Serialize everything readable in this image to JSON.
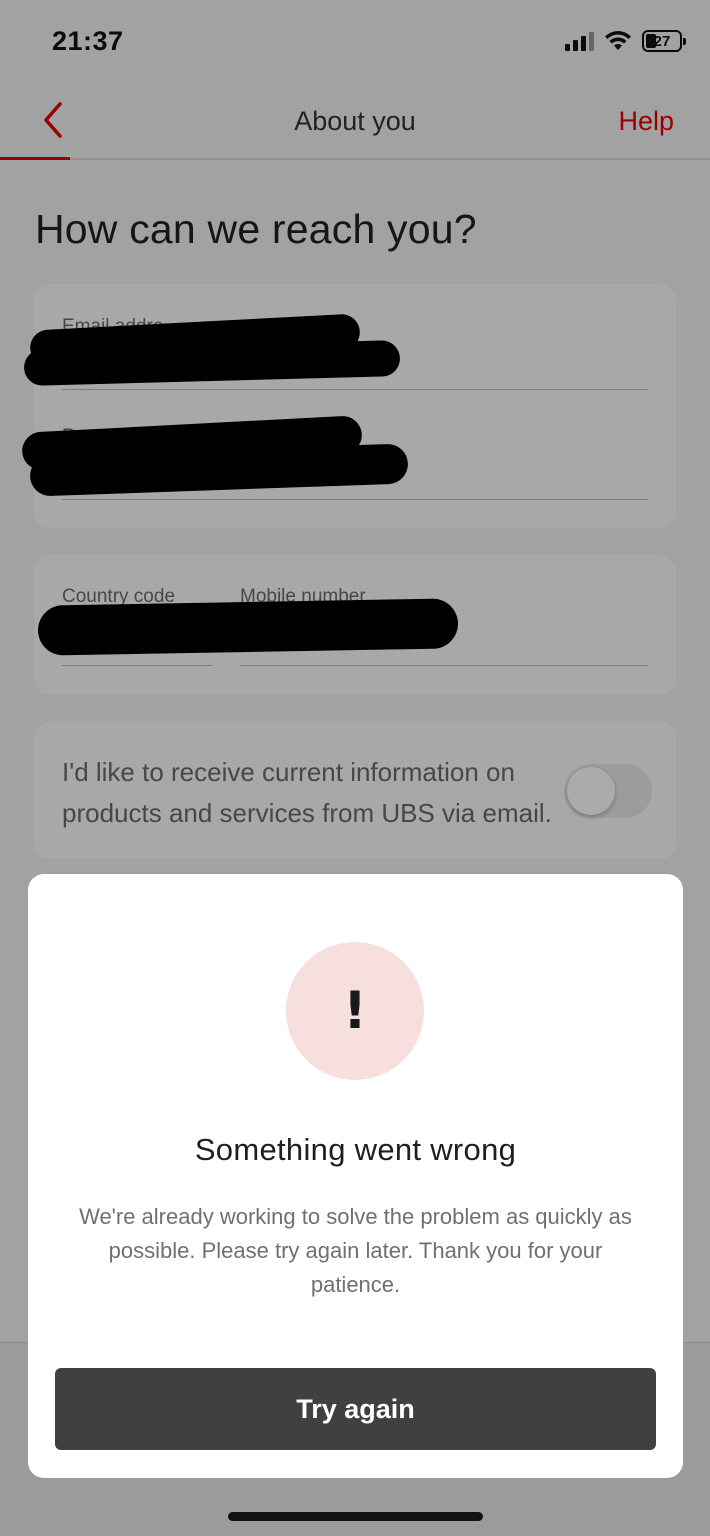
{
  "status_bar": {
    "time": "21:37",
    "battery": "27"
  },
  "nav": {
    "title": "About you",
    "help": "Help",
    "back_icon": "chevron-left-icon"
  },
  "page": {
    "heading": "How can we reach you?"
  },
  "form": {
    "email_label": "Email addre",
    "repeat_label": "Repe",
    "country_code_label": "Country code",
    "mobile_label": "Mobile number",
    "marketing_opt_in": "I'd like to receive current information on products and services from UBS via email.",
    "marketing_opt_in_enabled": false
  },
  "dialog": {
    "icon": "exclamation-icon",
    "icon_glyph": "!",
    "title": "Something went wrong",
    "message": "We're already working to solve the problem as quickly as possible. Please try again later. Thank you for your patience.",
    "button": "Try again"
  },
  "colors": {
    "accent": "#e60000",
    "alert_bg": "#f7dfdd",
    "button_bg": "#404040"
  }
}
